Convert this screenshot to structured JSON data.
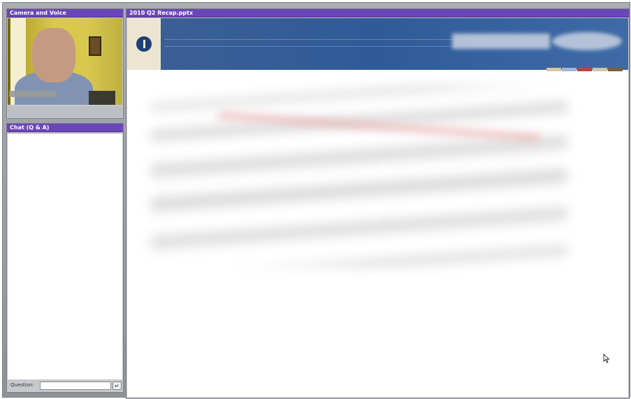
{
  "pods": {
    "camera": {
      "title": "Camera and Voice"
    },
    "chat": {
      "title": "Chat (Q & A)",
      "question_label": "Question:",
      "question_value": "",
      "send_label": "↵"
    },
    "share": {
      "title": "2010 Q2 Recap.pptx"
    }
  },
  "colors": {
    "pod_title_bar": "#6b46b9",
    "slide_banner": "#2f5b98",
    "slide_logo_box": "#ece5d2",
    "banner_stripes": [
      "#d8c89a",
      "#9fb5d9",
      "#b5463d",
      "#cfc6a6",
      "#7c5f3a"
    ]
  },
  "icons": {
    "slide_logo": "company-logo-icon",
    "cursor": "mouse-pointer-icon",
    "send": "enter-icon"
  }
}
